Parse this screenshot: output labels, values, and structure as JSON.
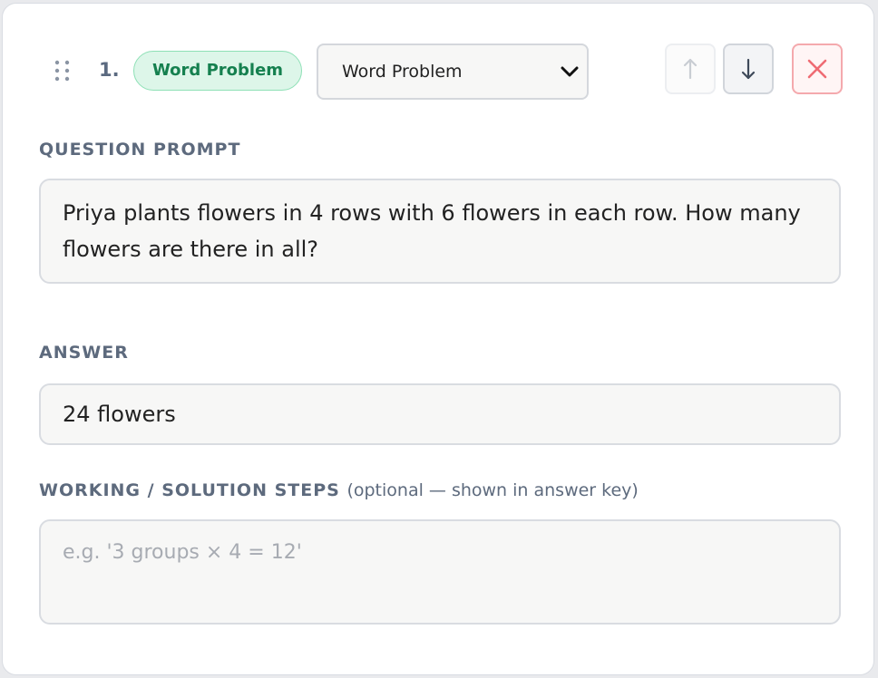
{
  "question": {
    "number": "1.",
    "type_badge": "Word Problem",
    "type_select": {
      "selected": "Word Problem"
    },
    "controls": {
      "move_up_icon": "arrow-up-icon",
      "move_down_icon": "arrow-down-icon",
      "delete_icon": "close-icon"
    },
    "prompt": {
      "label": "QUESTION PROMPT",
      "value": "Priya plants flowers in 4 rows with 6 flowers in each row. How many flowers are there in all?"
    },
    "answer": {
      "label": "ANSWER",
      "value": "24 flowers"
    },
    "steps": {
      "label": "WORKING / SOLUTION STEPS",
      "hint": "(optional — shown in answer key)",
      "placeholder": "e.g. '3 groups × 4 = 12'",
      "value": ""
    }
  },
  "colors": {
    "badge_text": "#15804f",
    "badge_bg": "#ddf6e9",
    "delete_red": "#ef6b73",
    "label_gray": "#5d6a7d"
  }
}
